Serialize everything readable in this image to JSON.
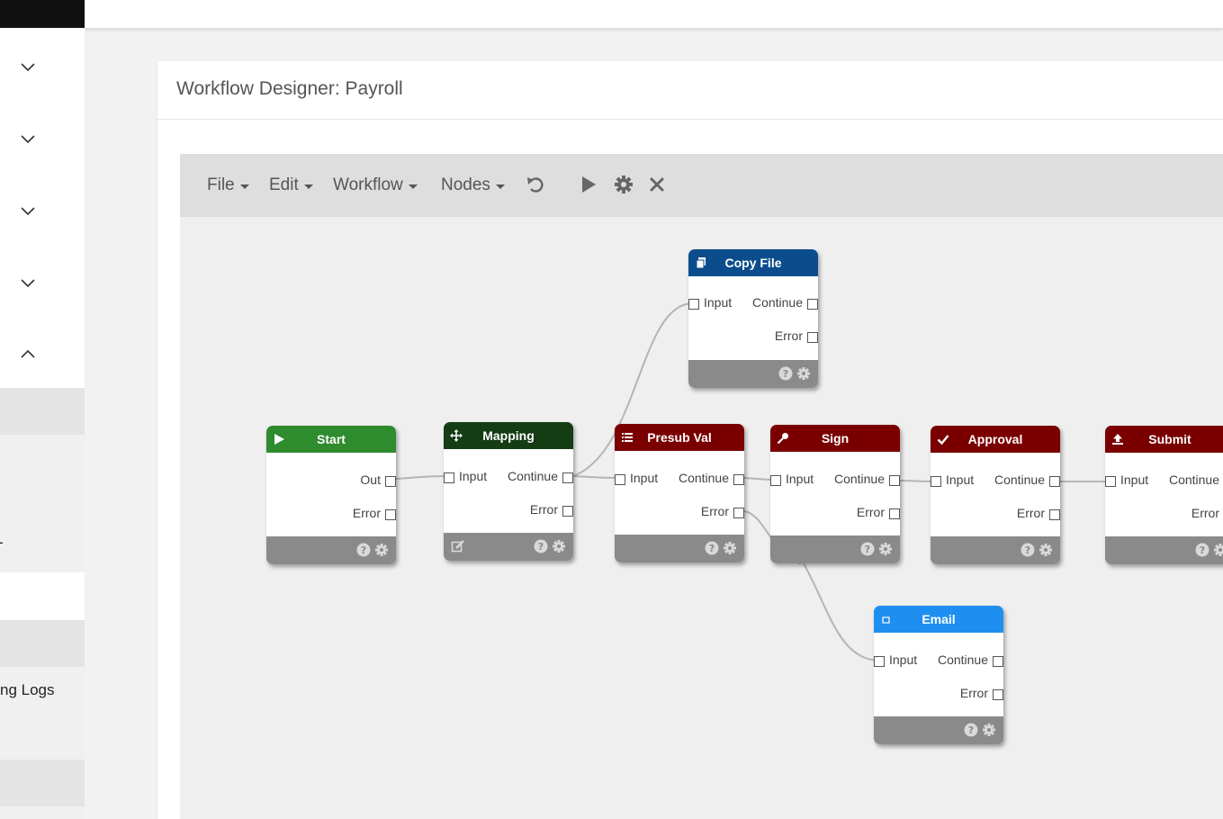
{
  "sidebar": {
    "items": [
      {
        "text": ""
      },
      {
        "text": "ng Logs"
      }
    ],
    "mark": "-"
  },
  "card": {
    "title": "Workflow Designer: Payroll"
  },
  "toolbar": {
    "menus": [
      {
        "label": "File"
      },
      {
        "label": "Edit"
      },
      {
        "label": "Workflow"
      },
      {
        "label": "Nodes"
      }
    ],
    "icons": [
      "undo-icon",
      "play-icon",
      "gear-icon",
      "close-icon"
    ]
  },
  "colors": {
    "green": "#2e8b2e",
    "darkgreen": "#143d14",
    "maroon": "#7a0000",
    "navy": "#0b4d8c",
    "blue": "#1e8ff0"
  },
  "nodes": {
    "start": {
      "title": "Start",
      "out": "Out",
      "error": "Error"
    },
    "mapping": {
      "title": "Mapping",
      "input": "Input",
      "continue": "Continue",
      "error": "Error"
    },
    "copyfile": {
      "title": "Copy File",
      "input": "Input",
      "continue": "Continue",
      "error": "Error"
    },
    "presub": {
      "title": "Presub Val",
      "input": "Input",
      "continue": "Continue",
      "error": "Error"
    },
    "sign": {
      "title": "Sign",
      "input": "Input",
      "continue": "Continue",
      "error": "Error"
    },
    "approval": {
      "title": "Approval",
      "input": "Input",
      "continue": "Continue",
      "error": "Error"
    },
    "submit": {
      "title": "Submit",
      "input": "Input",
      "continue": "Continue",
      "error": "Error"
    },
    "email": {
      "title": "Email",
      "input": "Input",
      "continue": "Continue",
      "error": "Error"
    }
  }
}
